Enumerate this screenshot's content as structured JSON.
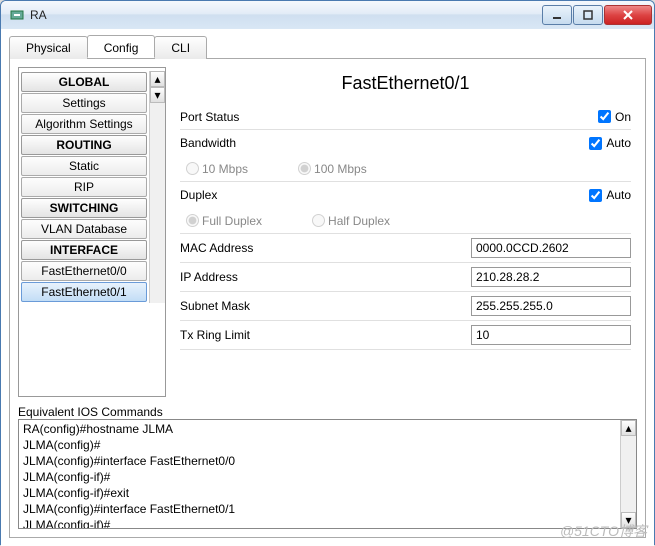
{
  "window": {
    "title": "RA"
  },
  "tabs": {
    "physical": "Physical",
    "config": "Config",
    "cli": "CLI"
  },
  "sidebar": {
    "groups": [
      {
        "header": "GLOBAL",
        "items": [
          "Settings",
          "Algorithm Settings"
        ]
      },
      {
        "header": "ROUTING",
        "items": [
          "Static",
          "RIP"
        ]
      },
      {
        "header": "SWITCHING",
        "items": [
          "VLAN Database"
        ]
      },
      {
        "header": "INTERFACE",
        "items": [
          "FastEthernet0/0",
          "FastEthernet0/1"
        ]
      }
    ],
    "selected": "FastEthernet0/1"
  },
  "interface": {
    "title": "FastEthernet0/1",
    "port_status": {
      "label": "Port Status",
      "on_label": "On",
      "checked": true
    },
    "bandwidth": {
      "label": "Bandwidth",
      "auto_label": "Auto",
      "auto": true,
      "opt1": "10 Mbps",
      "opt2": "100 Mbps",
      "selected": "100 Mbps"
    },
    "duplex": {
      "label": "Duplex",
      "auto_label": "Auto",
      "auto": true,
      "opt1": "Full Duplex",
      "opt2": "Half Duplex",
      "selected": "Full Duplex"
    },
    "mac": {
      "label": "MAC Address",
      "value": "0000.0CCD.2602"
    },
    "ip": {
      "label": "IP Address",
      "value": "210.28.28.2"
    },
    "mask": {
      "label": "Subnet Mask",
      "value": "255.255.255.0"
    },
    "txring": {
      "label": "Tx Ring Limit",
      "value": "10"
    }
  },
  "ios": {
    "label": "Equivalent IOS Commands",
    "lines": [
      "RA(config)#hostname JLMA",
      "JLMA(config)#",
      "JLMA(config)#interface FastEthernet0/0",
      "JLMA(config-if)#",
      "JLMA(config-if)#exit",
      "JLMA(config)#interface FastEthernet0/1",
      "JLMA(config-if)#"
    ]
  },
  "watermark": "@51CTO博客"
}
